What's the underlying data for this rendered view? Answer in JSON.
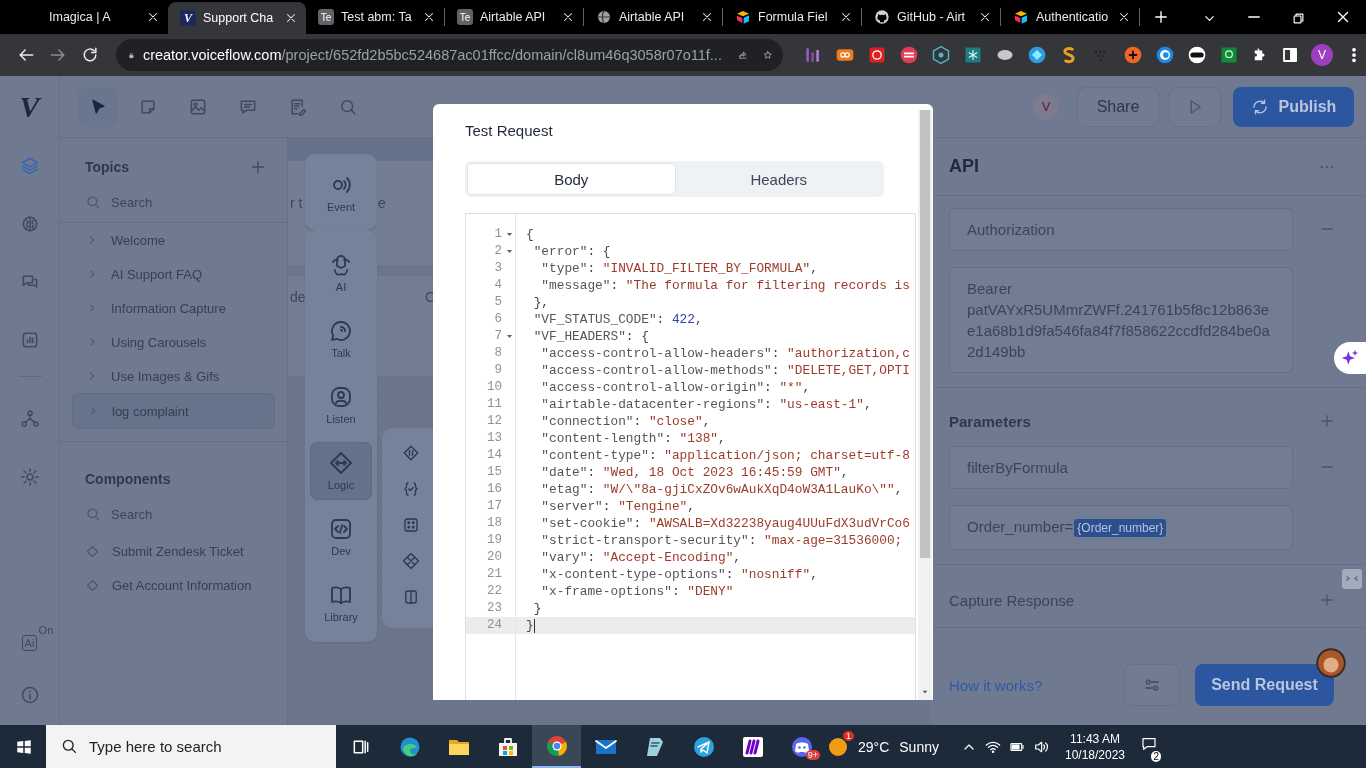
{
  "browser": {
    "tabs": [
      {
        "title": "Imagica | A",
        "selected": false
      },
      {
        "title": "Support Cha",
        "icon_text": "V",
        "selected": true
      },
      {
        "title": "Test abm: Ta",
        "icon_text": "Te",
        "selected": false
      },
      {
        "title": "Airtable API",
        "icon_text": "Te",
        "selected": false
      },
      {
        "title": "Airtable API",
        "selected": false
      },
      {
        "title": "Formula Fiel",
        "selected": false
      },
      {
        "title": "GitHub - Airt",
        "selected": false
      },
      {
        "title": "Authenticatio",
        "selected": false
      }
    ],
    "address": {
      "host": "creator.voiceflow.com",
      "path": "/project/652fd2b5bc524687ac01ffcc/domain/cl8um46q3058r07o11f..."
    },
    "profile": "V"
  },
  "app": {
    "logo": "V",
    "rail": [
      {
        "selected": true
      },
      {
        "selected": false
      },
      {
        "selected": false
      },
      {
        "selected": false
      }
    ],
    "rail_lower": [
      {
        "selected": false
      },
      {
        "selected": false
      }
    ],
    "ai_badge": {
      "text": "Ai",
      "status": "On"
    },
    "tools": [
      {
        "selected": true
      },
      {
        "selected": false
      },
      {
        "selected": false
      },
      {
        "selected": false
      },
      {
        "selected": false
      },
      {
        "selected": false
      }
    ],
    "topbar": {
      "avatar": "V",
      "share": "Share",
      "publish": "Publish"
    },
    "topics": {
      "title": "Topics",
      "search_placeholder": "Search",
      "items": [
        {
          "label": "Welcome",
          "selected": false
        },
        {
          "label": "AI Support FAQ",
          "selected": false
        },
        {
          "label": "Information Capture",
          "selected": false
        },
        {
          "label": "Using Carousels",
          "selected": false
        },
        {
          "label": "Use Images & Gifs",
          "selected": false
        },
        {
          "label": "log complaint",
          "selected": true
        }
      ]
    },
    "components": {
      "title": "Components",
      "search_placeholder": "Search",
      "items": [
        "Submit Zendesk Ticket",
        "Get Account Information"
      ]
    },
    "canvas": {
      "fragments": [
        "r t",
        "e",
        "de",
        "C"
      ],
      "palette_top": [
        {
          "label": "Event",
          "selected": false
        }
      ],
      "palette": [
        {
          "label": "AI",
          "selected": false
        },
        {
          "label": "Talk",
          "selected": false
        },
        {
          "label": "Listen",
          "selected": false
        },
        {
          "label": "Logic",
          "selected": true
        },
        {
          "label": "Dev",
          "selected": false
        },
        {
          "label": "Library",
          "selected": false
        }
      ]
    },
    "api_panel": {
      "title": "API",
      "header_key": "Authorization",
      "header_value": "Bearer patVAYxR5UMmrZWFf.241761b5f8c12b863ee1a68b1d9fa546fa84f7f858622ccdfd284be0a2d149bb",
      "parameters_title": "Parameters",
      "param_key": "filterByFormula",
      "param_prefix": "Order_number=",
      "param_variable": "{Order_number}",
      "capture_title": "Capture Response",
      "help_link": "How it works?",
      "send": "Send Request"
    }
  },
  "modal": {
    "title": "Test Request",
    "tabs": [
      {
        "label": "Body",
        "selected": true
      },
      {
        "label": "Headers",
        "selected": false
      }
    ],
    "lines": [
      {
        "number": "1",
        "text": "{",
        "foldable": true,
        "active": false
      },
      {
        "number": "2",
        "text": " \"error\": {",
        "foldable": true,
        "active": false
      },
      {
        "number": "3",
        "text": "  \"type\": \"INVALID_FILTER_BY_FORMULA\",",
        "foldable": false,
        "active": false
      },
      {
        "number": "4",
        "text": "  \"message\": \"The formula for filtering records is",
        "foldable": false,
        "active": false
      },
      {
        "number": "5",
        "text": " },",
        "foldable": false,
        "active": false
      },
      {
        "number": "6",
        "text": " \"VF_STATUS_CODE\": 422,",
        "foldable": false,
        "active": false
      },
      {
        "number": "7",
        "text": " \"VF_HEADERS\": {",
        "foldable": true,
        "active": false
      },
      {
        "number": "8",
        "text": "  \"access-control-allow-headers\": \"authorization,c",
        "foldable": false,
        "active": false
      },
      {
        "number": "9",
        "text": "  \"access-control-allow-methods\": \"DELETE,GET,OPTI",
        "foldable": false,
        "active": false
      },
      {
        "number": "10",
        "text": "  \"access-control-allow-origin\": \"*\",",
        "foldable": false,
        "active": false
      },
      {
        "number": "11",
        "text": "  \"airtable-datacenter-regions\": \"us-east-1\",",
        "foldable": false,
        "active": false
      },
      {
        "number": "12",
        "text": "  \"connection\": \"close\",",
        "foldable": false,
        "active": false
      },
      {
        "number": "13",
        "text": "  \"content-length\": \"138\",",
        "foldable": false,
        "active": false
      },
      {
        "number": "14",
        "text": "  \"content-type\": \"application/json; charset=utf-8",
        "foldable": false,
        "active": false
      },
      {
        "number": "15",
        "text": "  \"date\": \"Wed, 18 Oct 2023 16:45:59 GMT\",",
        "foldable": false,
        "active": false
      },
      {
        "number": "16",
        "text": "  \"etag\": \"W/\\\"8a-gjiCxZOv6wAukXqD4oW3A1LauKo\\\"\",",
        "foldable": false,
        "active": false
      },
      {
        "number": "17",
        "text": "  \"server\": \"Tengine\",",
        "foldable": false,
        "active": false
      },
      {
        "number": "18",
        "text": "  \"set-cookie\": \"AWSALB=Xd32238yaug4UUuFdX3udVrCo6",
        "foldable": false,
        "active": false
      },
      {
        "number": "19",
        "text": "  \"strict-transport-security\": \"max-age=31536000;",
        "foldable": false,
        "active": false
      },
      {
        "number": "20",
        "text": "  \"vary\": \"Accept-Encoding\",",
        "foldable": false,
        "active": false
      },
      {
        "number": "21",
        "text": "  \"x-content-type-options\": \"nosniff\",",
        "foldable": false,
        "active": false
      },
      {
        "number": "22",
        "text": "  \"x-frame-options\": \"DENY\"",
        "foldable": false,
        "active": false
      },
      {
        "number": "23",
        "text": " }",
        "foldable": false,
        "active": false
      },
      {
        "number": "24",
        "text": "}",
        "foldable": false,
        "active": true
      }
    ]
  },
  "taskbar": {
    "search_placeholder": "Type here to search",
    "apps": [
      {
        "selected": false
      },
      {
        "selected": false
      },
      {
        "selected": false
      },
      {
        "selected": true
      },
      {
        "selected": false
      },
      {
        "selected": false
      },
      {
        "selected": false
      },
      {
        "selected": false
      },
      {
        "selected": false,
        "badge": "9+"
      }
    ],
    "weather_badge": "1",
    "temperature": "29°C",
    "condition": "Sunny",
    "time": "11:43 AM",
    "date": "10/18/2023",
    "notifications": "2"
  }
}
